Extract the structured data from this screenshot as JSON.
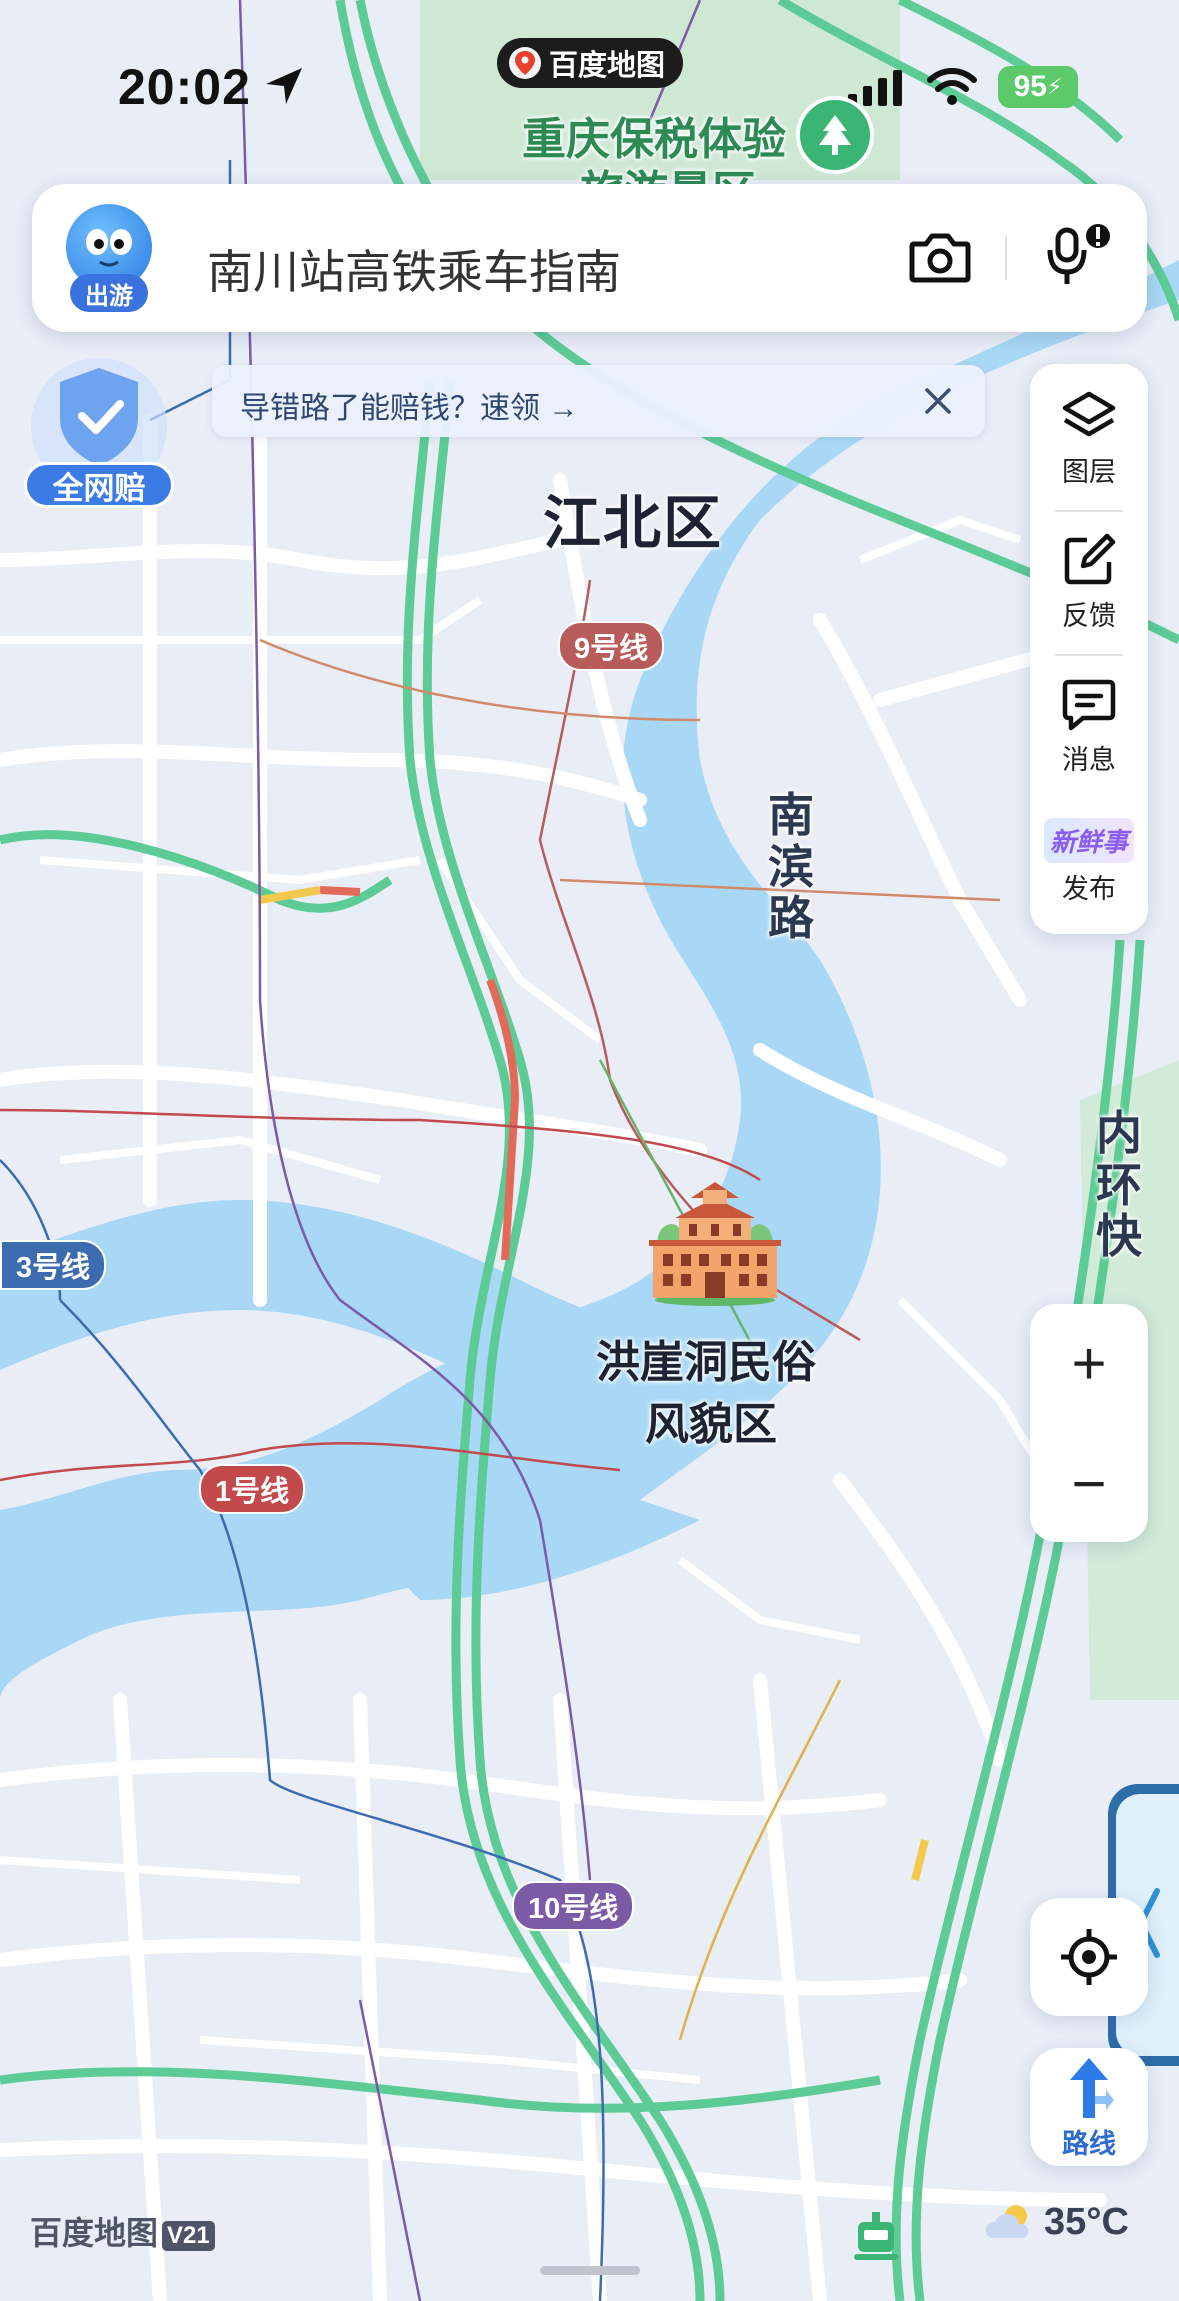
{
  "status_bar": {
    "time": "20:02",
    "app_badge": "百度地图",
    "battery": "95"
  },
  "search": {
    "mascot_label": "出游",
    "placeholder": "南川站高铁乘车指南"
  },
  "banner": {
    "text": "导错路了能赔钱？速领 →"
  },
  "badge": {
    "label": "全网赔"
  },
  "tools": [
    {
      "label": "图层",
      "icon": "layers-icon"
    },
    {
      "label": "反馈",
      "icon": "edit-icon"
    },
    {
      "label": "消息",
      "icon": "message-icon"
    },
    {
      "label": "发布",
      "icon": "news-icon",
      "badge": "新鲜事"
    }
  ],
  "zoom": {
    "in": "+",
    "out": "−"
  },
  "route": {
    "label": "路线"
  },
  "map_labels": {
    "park": "重庆保税体验",
    "park_line2": "旅游景区",
    "district": "江北区",
    "road_nanbin": [
      "南",
      "滨",
      "路"
    ],
    "road_neihuan": [
      "内",
      "环",
      "快"
    ],
    "landmark_line1": "洪崖洞民俗",
    "landmark_line2": "风貌区"
  },
  "metro_lines": [
    {
      "label": "9号线",
      "color": "#b75b5b"
    },
    {
      "label": "3号线",
      "color": "#3d6bb0"
    },
    {
      "label": "1号线",
      "color": "#c24a4d"
    },
    {
      "label": "10号线",
      "color": "#7b5aa6"
    }
  ],
  "footer": {
    "brand": "百度地图",
    "version": "V21",
    "temperature": "35°C"
  },
  "colors": {
    "water": "#a8d8f5",
    "land": "#e9edf6",
    "road": "#ffffff",
    "expressway": "#5ccb96",
    "accent": "#3b7be6"
  }
}
